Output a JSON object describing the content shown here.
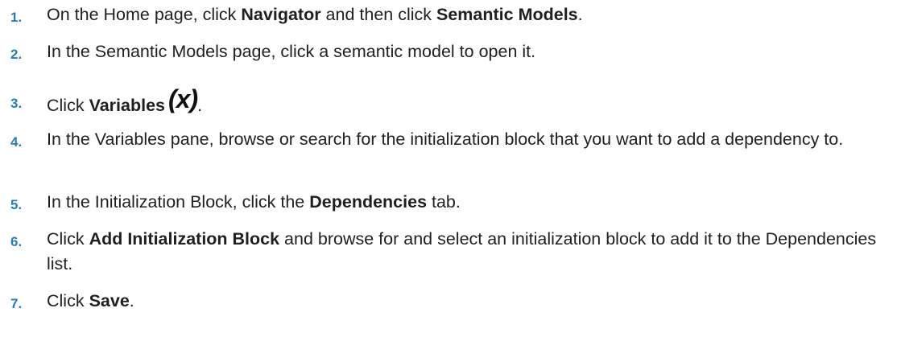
{
  "steps": [
    {
      "number": "1.",
      "parts": [
        "On the Home page, click ",
        "Navigator",
        " and then click ",
        "Semantic Models",
        "."
      ]
    },
    {
      "number": "2.",
      "parts": [
        "In the Semantic Models page, click a semantic model to open it."
      ]
    },
    {
      "number": "3.",
      "parts": [
        "Click ",
        "Variables",
        "."
      ],
      "icon": {
        "name": "variables-icon",
        "glyph": "(x)"
      }
    },
    {
      "number": "4.",
      "parts": [
        "In the Variables pane, browse or search for the initialization block that you want to add a dependency to."
      ]
    },
    {
      "number": "5.",
      "parts": [
        "In the Initialization Block, click the ",
        "Dependencies",
        " tab."
      ]
    },
    {
      "number": "6.",
      "parts": [
        "Click ",
        "Add Initialization Block",
        " and browse for and select an initialization block to add it to the Dependencies list."
      ]
    },
    {
      "number": "7.",
      "parts": [
        "Click ",
        "Save",
        "."
      ]
    }
  ],
  "colors": {
    "step_number": "#2a7db2",
    "text": "#1f1f1f"
  }
}
